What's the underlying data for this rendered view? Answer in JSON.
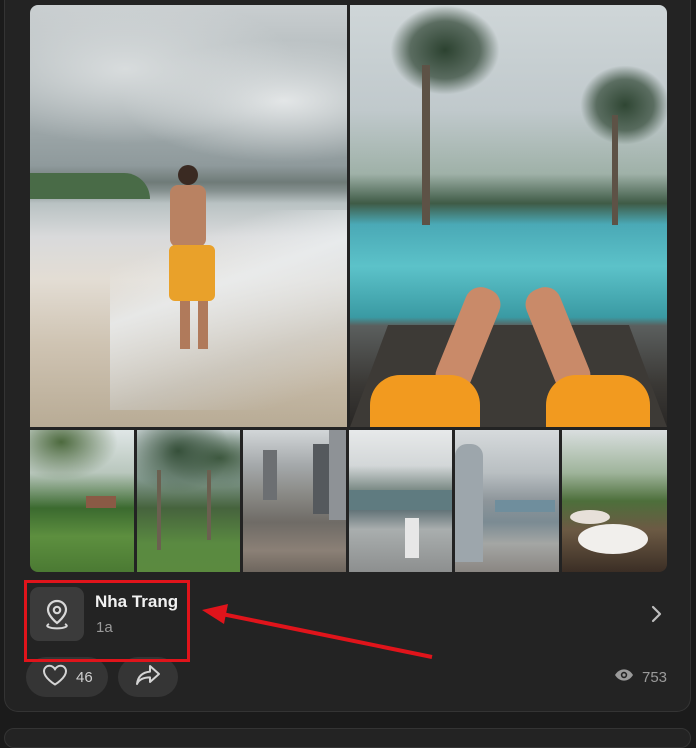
{
  "post": {
    "photos": [
      {
        "name": "beach-photo"
      },
      {
        "name": "pool-photo"
      },
      {
        "name": "garden-photo"
      },
      {
        "name": "palm-grove-photo"
      },
      {
        "name": "city-skyline-photo"
      },
      {
        "name": "coast-city-photo"
      },
      {
        "name": "tower-photo"
      },
      {
        "name": "breakfast-photo"
      }
    ],
    "location": {
      "name": "Nha Trang",
      "subtitle": "1a",
      "icon": "location-pin-icon"
    },
    "actions": {
      "like_count": "46",
      "like_icon": "heart-icon",
      "share_icon": "share-arrow-icon"
    },
    "views": {
      "count": "753",
      "icon": "eye-icon"
    }
  },
  "colors": {
    "background": "#1b1b1b",
    "card": "#232323",
    "pill": "#353535",
    "annotation": "#e0141b"
  }
}
